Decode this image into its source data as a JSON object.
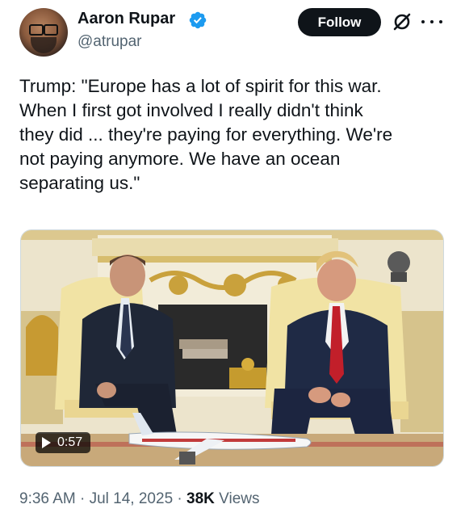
{
  "author": {
    "display_name": "Aaron Rupar",
    "handle": "@atrupar",
    "verified": true
  },
  "actions": {
    "follow_label": "Follow",
    "grok_icon": "grok-icon",
    "more_icon": "more-icon"
  },
  "tweet": {
    "text": "Trump: \"Europe has a lot of spirit for this war.\nWhen I first got involved I really didn't think\nthey did ... they're paying for everything. We're\nnot paying anymore. We have an ocean\nseparating us.\""
  },
  "media": {
    "type": "video",
    "duration": "0:57"
  },
  "meta": {
    "time": "9:36 AM",
    "separator": "·",
    "date": "Jul 14, 2025",
    "views_count": "38K",
    "views_label": "Views"
  },
  "colors": {
    "text_primary": "#0f1419",
    "text_secondary": "#536471",
    "verified_blue": "#1d9bf0",
    "follow_bg": "#0f1419"
  }
}
